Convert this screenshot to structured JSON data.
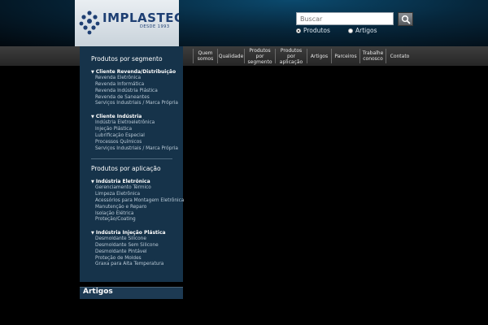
{
  "brand": {
    "name": "IMPLASTEC",
    "tagline": "DESDE 1993"
  },
  "search": {
    "placeholder": "Buscar",
    "options": [
      {
        "label": "Produtos",
        "selected": true
      },
      {
        "label": "Artigos",
        "selected": false
      }
    ]
  },
  "nav": {
    "items": [
      {
        "label": "Quem somos"
      },
      {
        "label": "Qualidade"
      },
      {
        "label": "Produtos por segmento"
      },
      {
        "label": "Produtos por aplicação"
      },
      {
        "label": "Artigos"
      },
      {
        "label": "Parceiros"
      },
      {
        "label": "Trabalhe conosco"
      },
      {
        "label": "Contato"
      }
    ]
  },
  "sidebar": {
    "segment_heading": "Produtos por segmento",
    "segment_groups": [
      {
        "title": "Cliente Revenda/Distribuição",
        "links": [
          "Revenda Eletrônica",
          "Revenda Informática",
          "Revenda Indústria Plástica",
          "Revenda de Saneantes",
          "Serviços Industriais / Marca Própria"
        ]
      },
      {
        "title": "Cliente Indústria",
        "links": [
          "Indústria Eletroeletrônica",
          "Injeção Plástica",
          "Lubrificação Especial",
          "Processos Químicos",
          "Serviços Industriais / Marca Própria"
        ]
      }
    ],
    "application_heading": "Produtos por aplicação",
    "application_groups": [
      {
        "title": "Indústria Eletrônica",
        "links": [
          "Gerenciamento Térmico",
          "Limpeza Eletrônica",
          "Acessórios para Montagem Eletrônica",
          "Manutenção e Reparo",
          "Isolação Elétrica",
          "Proteção/Coating"
        ]
      },
      {
        "title": "Indústria Injeção Plástica",
        "links": [
          "Desmoldante Silicone",
          "Desmoldante Sem Silicone",
          "Desmoldante Pintável",
          "Proteção de Moldes",
          "Graxa para Alta Temperatura"
        ]
      }
    ]
  },
  "artigos": {
    "title": "Artigos"
  },
  "colors": {
    "sidebar_bg": "#16334a",
    "nav_bg": "#2e2e2e",
    "logo_text": "#1e3f73"
  }
}
